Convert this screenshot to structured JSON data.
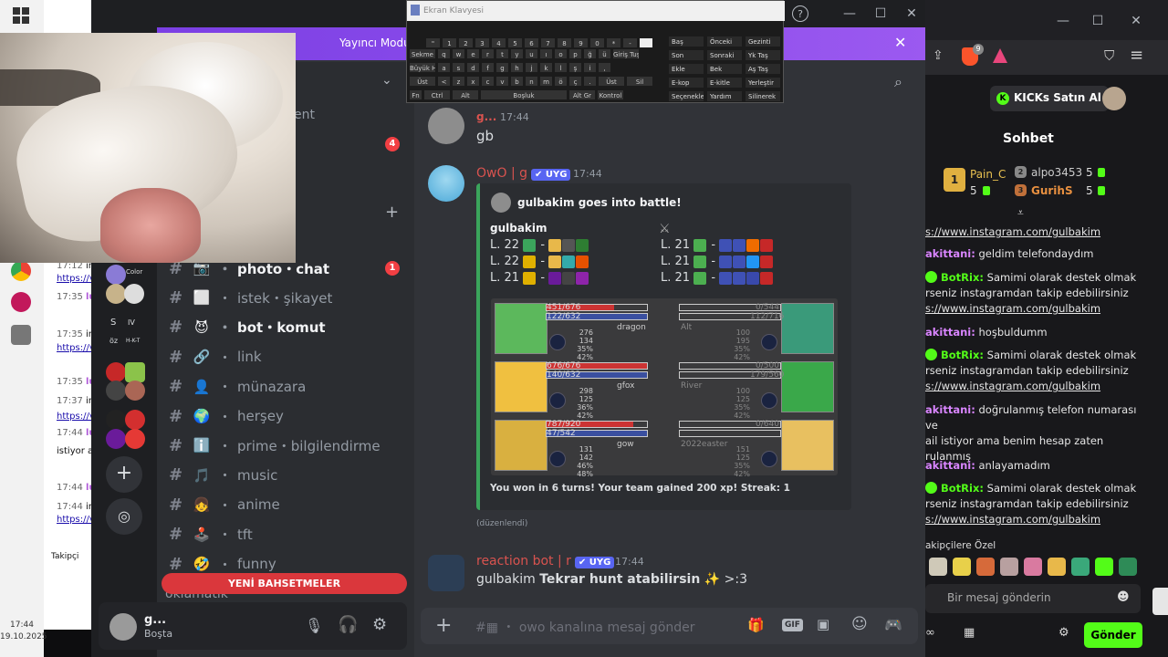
{
  "os": {
    "clock_time": "17:44",
    "clock_date": "19.10.2025"
  },
  "bg_chat": {
    "rows": [
      {
        "time": "17:12",
        "text": "instagra"
      },
      {
        "time": "",
        "text": "https://v"
      },
      {
        "time": "17:35",
        "user": "lur"
      },
      {
        "time": "17:35",
        "text": "instagra"
      },
      {
        "time": "",
        "text": "https://v"
      },
      {
        "time": "17:35",
        "user": "lur"
      },
      {
        "time": "17:37",
        "text": "instagra"
      },
      {
        "time": "",
        "text": "https://v"
      },
      {
        "time": "17:44",
        "user": "lur"
      },
      {
        "time": "",
        "text": "istiyor a"
      },
      {
        "time": "17:44",
        "user": "lur"
      },
      {
        "time": "17:44",
        "text": "instagra"
      },
      {
        "time": "",
        "text": "https://v"
      }
    ],
    "followers_label": "Takipçi"
  },
  "discord": {
    "banner_text": "Yayıncı Modu",
    "channel_partial": "ent",
    "unread_count_1": "4",
    "unread_count_2": "1",
    "channels": [
      {
        "emoji": "📷",
        "name": "photo・chat",
        "bold": true
      },
      {
        "emoji": "⬜",
        "name": "istek・şikayet",
        "bold": false
      },
      {
        "emoji": "😈",
        "name": "bot・komut",
        "bold": true
      },
      {
        "emoji": "🔗",
        "name": "link",
        "bold": false
      },
      {
        "emoji": "👤",
        "name": "münazara",
        "bold": false
      },
      {
        "emoji": "🌍",
        "name": "herşey",
        "bold": false
      },
      {
        "emoji": "ℹ️",
        "name": "prime・bilgilendirme",
        "bold": false
      },
      {
        "emoji": "🎵",
        "name": "music",
        "bold": false
      },
      {
        "emoji": "👧",
        "name": "anime",
        "bold": false
      },
      {
        "emoji": "🕹️",
        "name": "tft",
        "bold": false
      },
      {
        "emoji": "🤣",
        "name": "funny",
        "bold": false
      }
    ],
    "mention_bar": "YENİ BAHSETMELER",
    "partial_channel_last": "oklamatik",
    "user": {
      "name": "g...",
      "status": "Boşta"
    },
    "server_labels": {
      "s": "S",
      "iv": "IV",
      "oz": "öz",
      "hkt": "H-K-T",
      "color": "Color"
    },
    "messages": [
      {
        "author": "g...",
        "time": "17:44",
        "text": "gb"
      },
      {
        "author": "OwO | g",
        "tag": "✔ UYG",
        "time": "17:44"
      },
      {
        "author": "reaction bot | r",
        "tag": "✔ UYG",
        "time": "17:44",
        "text_pre": "gulbakim ",
        "text_bold": "Tekrar hunt atabilirsin",
        "text_post": " ✨ >:3"
      }
    ],
    "embed": {
      "title": "gulbakim goes into battle!",
      "team_left_name": "gulbakim",
      "team_left": [
        "L. 22",
        "L. 22",
        "L. 21"
      ],
      "team_right": [
        "L. 21",
        "L. 21",
        "L. 21"
      ],
      "footer": "You won in 6 turns! Your team gained 200 xp! Streak: 1",
      "edited": "(düzenlendi)",
      "battle": {
        "left": [
          {
            "hp": "451/676",
            "wp": "122/632",
            "hp_frac": 0.67,
            "name": "dragon",
            "stats": [
              "276",
              "134",
              "35%",
              "42%"
            ]
          },
          {
            "hp": "676/676",
            "wp": "140/632",
            "hp_frac": 1.0,
            "name": "gfox",
            "stats": [
              "298",
              "125",
              "36%",
              "42%"
            ]
          },
          {
            "hp": "787/920",
            "wp": "47/542",
            "hp_frac": 0.86,
            "name": "gow",
            "stats": [
              "131",
              "142",
              "46%",
              "48%"
            ]
          }
        ],
        "right": [
          {
            "hp": "0/544",
            "wp": "112/716",
            "name": "Alt",
            "stats": [
              "100",
              "195",
              "35%",
              "42%"
            ]
          },
          {
            "hp": "0/500",
            "wp": "179/560",
            "name": "River",
            "stats": [
              "100",
              "125",
              "35%",
              "42%"
            ]
          },
          {
            "hp": "0/640",
            "wp": "",
            "name": "2022easter",
            "stats": [
              "151",
              "125",
              "35%",
              "42%"
            ]
          }
        ]
      }
    },
    "composer_placeholder": "owo kanalına mesaj gönder"
  },
  "osk": {
    "title": "Ekran Klavyesi",
    "rows": [
      [
        "Sekme",
        "q",
        "w",
        "e",
        "r",
        "t",
        "y",
        "u",
        "ı",
        "o",
        "p",
        "ğ",
        "ü",
        "Giriş Tuşu"
      ],
      [
        "Büyük Harf",
        "a",
        "s",
        "d",
        "f",
        "g",
        "h",
        "j",
        "k",
        "l",
        "ş",
        "i",
        ","
      ],
      [
        "Üst",
        "<",
        "z",
        "x",
        "c",
        "v",
        "b",
        "n",
        "m",
        "ö",
        "ç",
        ".",
        "Üst",
        "Sil"
      ],
      [
        "Fn",
        "Ctrl",
        "Alt",
        "Boşluk",
        "Alt Gr",
        "Kontrol"
      ]
    ],
    "top_row": [
      "\"",
      "1",
      "2",
      "3",
      "4",
      "5",
      "6",
      "7",
      "8",
      "9",
      "0",
      "*",
      "-"
    ],
    "side_keys": [
      [
        "Baş",
        "Önceki",
        "Gezinti"
      ],
      [
        "Son",
        "Sonraki",
        "Yk Taş"
      ],
      [
        "Ekle",
        "Bek",
        "Aş Taş"
      ],
      [
        "E-kop",
        "E-kitle",
        "Yerleştir"
      ],
      [
        "Seçenekler",
        "Yardım",
        "Silinerek"
      ]
    ]
  },
  "kick": {
    "buy_button": "KICKs Satın Al",
    "chat_title": "Sohbet",
    "leaders": [
      {
        "rank": "1",
        "name": "Pain_C",
        "count": "5"
      },
      {
        "rank": "2",
        "name": "alpo3453",
        "count": "5"
      },
      {
        "rank": "3",
        "name": "GurihS",
        "count": "5"
      }
    ],
    "lines": [
      {
        "type": "link",
        "text": "s://www.instagram.com/gulbakim"
      },
      {
        "type": "user",
        "user": "akittani:",
        "text": " geldim telefondaydım"
      },
      {
        "type": "bot",
        "user": "BotRix:",
        "text": " Samimi olarak destek olmak",
        "text2": "rseniz instagramdan takip edebilirsiniz",
        "link": "s://www.instagram.com/gulbakim"
      },
      {
        "type": "user",
        "user": "akittani:",
        "text": " hoşbuldumm"
      },
      {
        "type": "bot",
        "user": "BotRix:",
        "text": " Samimi olarak destek olmak",
        "text2": "rseniz instagramdan takip edebilirsiniz",
        "link": "s://www.instagram.com/gulbakim"
      },
      {
        "type": "user",
        "user": "akittani:",
        "text": " doğrulanmış telefon numarası ve",
        "text2": "ail istiyor ama benim hesap zaten",
        "text3": "rulanmış"
      },
      {
        "type": "user",
        "user": "akittani:",
        "text": " anlayamadım"
      },
      {
        "type": "bot",
        "user": "BotRix:",
        "text": " Samimi olarak destek olmak",
        "text2": "rseniz instagramdan takip edebilirsiniz",
        "link": "s://www.instagram.com/gulbakim"
      }
    ],
    "followers_only": "akipçilere Özel",
    "input_placeholder": "Bir mesaj gönderin",
    "send_button": "Gönder",
    "ext_badge": "9"
  }
}
